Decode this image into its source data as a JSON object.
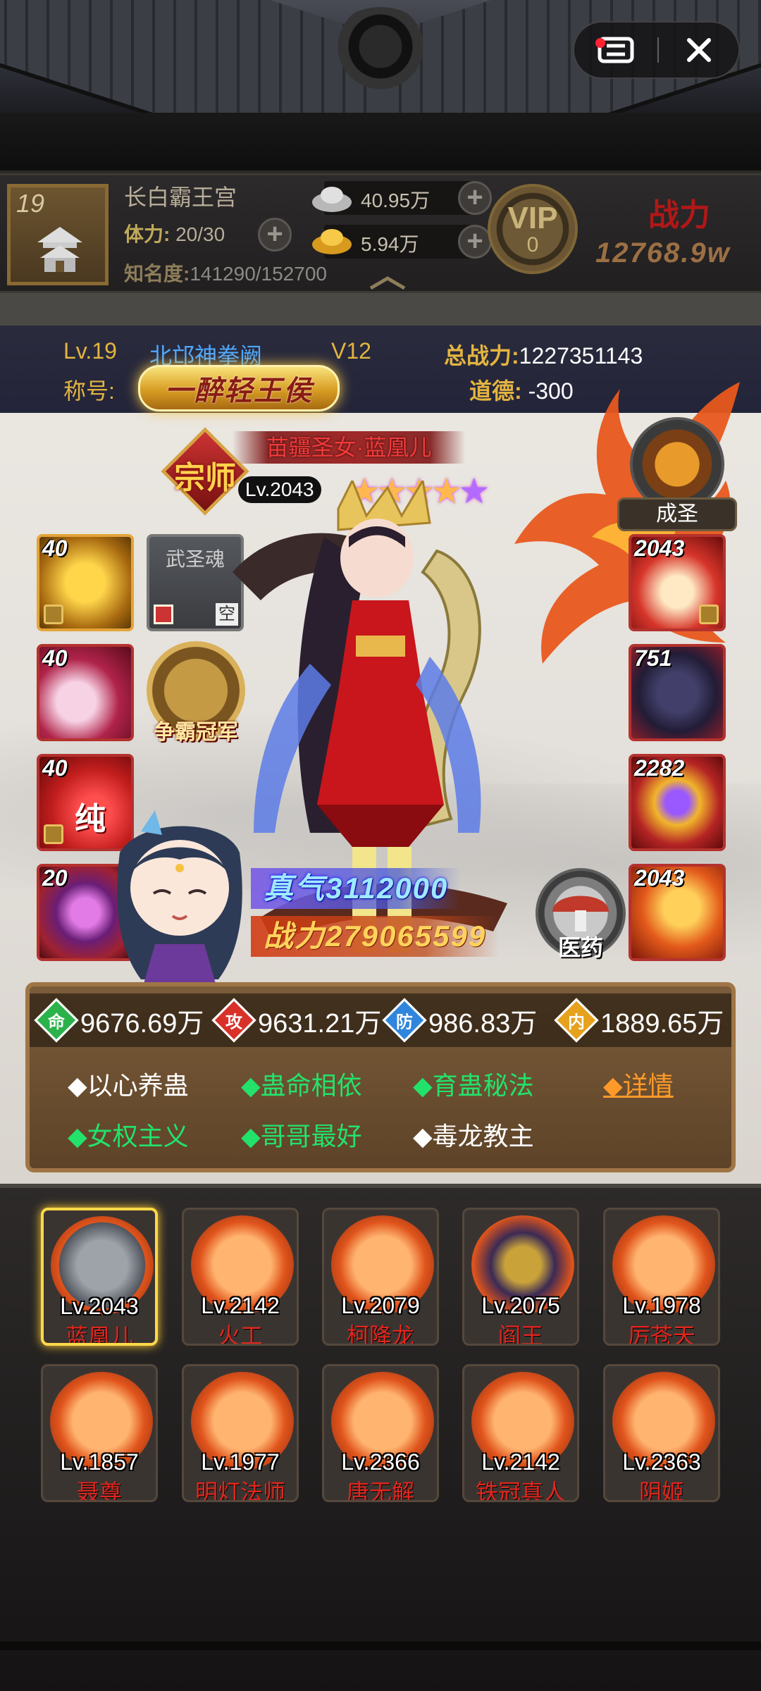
{
  "window": {
    "menu_icon": "menu-icon",
    "close_icon": "close-icon"
  },
  "resources": {
    "player_level": "19",
    "location": "长白霸王宫",
    "stamina_label": "体力:",
    "stamina_value": "20/30",
    "fame_label": "知名度:",
    "fame_value": "141290/152700",
    "silver": "40.95万",
    "gold": "5.94万",
    "vip_label": "VIP",
    "vip_level": "0",
    "power_label": "战力",
    "power_value": "12768.9w"
  },
  "hero_info": {
    "level": "Lv.19",
    "server": "北邙神拳阙",
    "vip": "V12",
    "total_power_label": "总战力:",
    "total_power": "1227351143",
    "title_label": "称号:",
    "title": "一醉轻王侯",
    "morality_label": "道德:",
    "morality": "-300"
  },
  "hero": {
    "rank_emblem": "宗师",
    "name": "苗疆圣女·蓝凰儿",
    "level": "Lv.2043",
    "stars": 5,
    "sage_label": "成圣",
    "badge_label": "争霸冠军",
    "zhenqi": "真气3112000",
    "zhanli": "战力279065599",
    "medicine_label": "医药"
  },
  "slots_left": [
    {
      "num": "40"
    },
    {
      "label": "武圣魂",
      "empty": "空"
    },
    {
      "num": "40"
    },
    {
      "num": "40",
      "tag": "纯"
    },
    {
      "num": "20"
    }
  ],
  "slots_right": [
    {
      "num": "2043"
    },
    {
      "num": "751"
    },
    {
      "num": "2282"
    },
    {
      "num": "2043"
    }
  ],
  "stats": [
    {
      "icon": "命",
      "value": "9676.69万",
      "color": "#2bb24a"
    },
    {
      "icon": "攻",
      "value": "9631.21万",
      "color": "#d8312a"
    },
    {
      "icon": "防",
      "value": "986.83万",
      "color": "#2f86dc"
    },
    {
      "icon": "内",
      "value": "1889.65万",
      "color": "#e6a11d"
    }
  ],
  "skills": [
    {
      "text": "◆以心养蛊",
      "color": "white"
    },
    {
      "text": "◆蛊命相依",
      "color": "green"
    },
    {
      "text": "◆育蛊秘法",
      "color": "green"
    },
    {
      "text": "◆详情",
      "color": "orange"
    },
    {
      "text": "◆女权主义",
      "color": "green"
    },
    {
      "text": "◆哥哥最好",
      "color": "green"
    },
    {
      "text": "◆毒龙教主",
      "color": "white"
    }
  ],
  "heroes": [
    {
      "level": "Lv.2043",
      "name": "蓝凰儿",
      "selected": true
    },
    {
      "level": "Lv.2142",
      "name": "火工"
    },
    {
      "level": "Lv.2079",
      "name": "柯降龙"
    },
    {
      "level": "Lv.2075",
      "name": "阎王"
    },
    {
      "level": "Lv.1978",
      "name": "厉苍天"
    },
    {
      "level": "Lv.1857",
      "name": "聂尊"
    },
    {
      "level": "Lv.1977",
      "name": "明灯法师"
    },
    {
      "level": "Lv.2366",
      "name": "唐无解"
    },
    {
      "level": "Lv.2142",
      "name": "铁冠真人"
    },
    {
      "level": "Lv.2363",
      "name": "阴姬"
    }
  ]
}
